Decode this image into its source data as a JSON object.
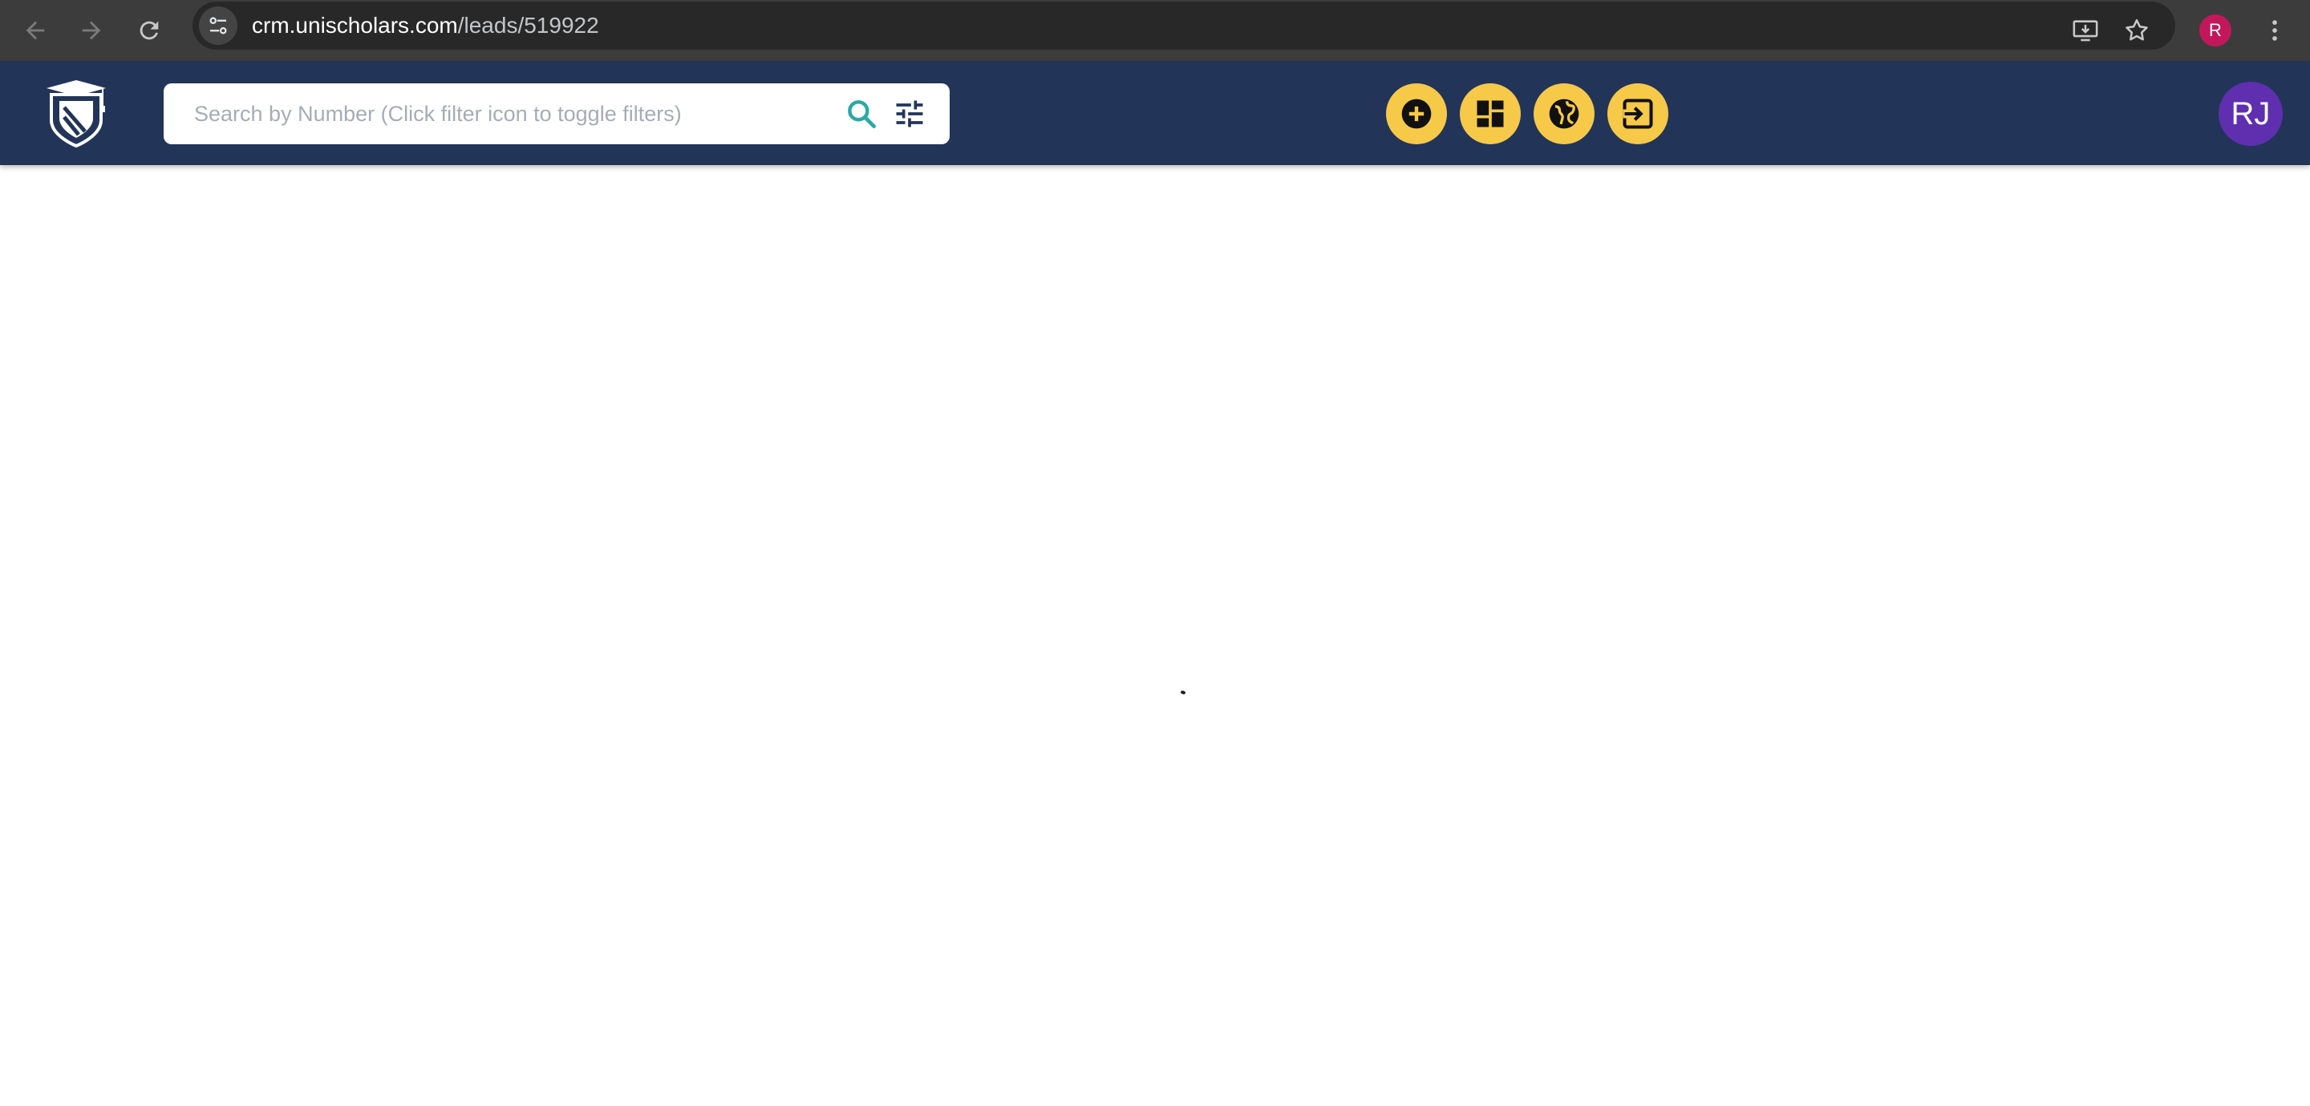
{
  "browser": {
    "url_host": "crm.unischolars.com",
    "url_path": "/leads/519922",
    "profile_initial": "R",
    "icons": [
      "back-arrow-icon",
      "forward-arrow-icon",
      "reload-icon",
      "site-info-icon",
      "install-app-icon",
      "bookmark-star-icon",
      "kebab-menu-icon"
    ]
  },
  "header": {
    "logo": "unischolars-logo",
    "search": {
      "placeholder": "Search by Number (Click filter icon to toggle filters)",
      "value": ""
    },
    "actions": [
      {
        "name": "add",
        "icon": "add-circle-icon"
      },
      {
        "name": "dashboard",
        "icon": "dashboard-icon"
      },
      {
        "name": "globe",
        "icon": "globe-icon"
      },
      {
        "name": "logout",
        "icon": "exit-icon"
      }
    ],
    "user_initials": "RJ"
  },
  "colors": {
    "header_bg": "#223559",
    "action_bg": "#f7c948",
    "avatar_bg": "#5f2fb0",
    "search_icon": "#2aa8a8"
  }
}
